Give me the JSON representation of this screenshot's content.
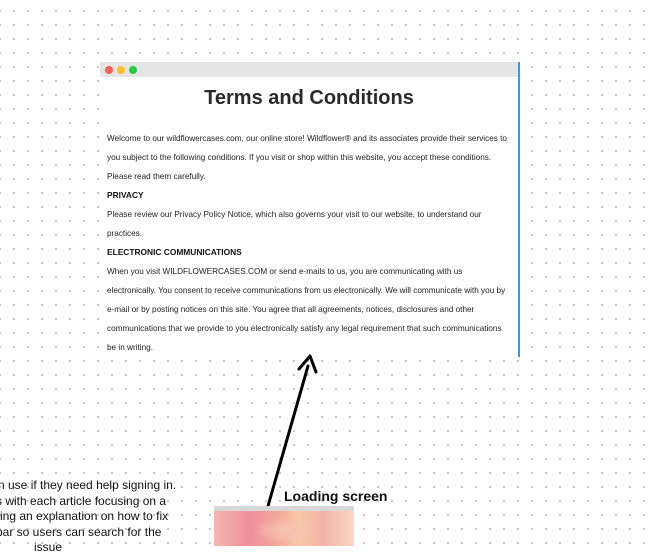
{
  "terms_window": {
    "title": "Terms and Conditions",
    "intro": "Welcome to our wildflowercases.com, our online store! Wildflower® and its associates provide their services to you subject to the following conditions. If you visit or shop within this website, you accept these conditions. Please read them carefully.",
    "sections": [
      {
        "heading": "PRIVACY",
        "text": "Please review our Privacy Policy Notice, which also governs your visit to our website, to understand our practices."
      },
      {
        "heading": "ELECTRONIC COMMUNICATIONS",
        "text": "When you visit WILDFLOWERCASES.COM or send e-mails to us, you are communicating with us electronically. You consent to receive communications from us electronically. We will communicate with you by e-mail or by posting notices on this site. You agree that all agreements, notices, disclosures and other communications that we provide to you electronically satisfy any legal requirement that such communications be in writing."
      }
    ]
  },
  "annotation": {
    "label": "Loading screen"
  },
  "sidenote": {
    "lines": [
      "n use if they need help signing in.",
      "s with each article focusing on a",
      "ring an explanation on how to fix",
      "bar so users can search for the",
      "issue"
    ]
  }
}
